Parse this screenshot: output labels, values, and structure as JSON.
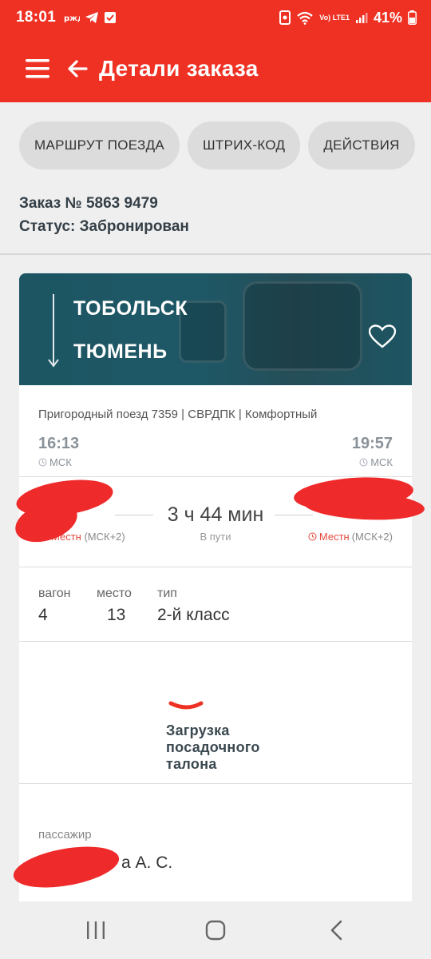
{
  "status_bar": {
    "time": "18:01",
    "battery_percent": "41%",
    "network_label": "Vo) LTE1"
  },
  "app_bar": {
    "title": "Детали заказа"
  },
  "chips": [
    {
      "label": "МАРШРУТ ПОЕЗДА"
    },
    {
      "label": "ШТРИХ-КОД"
    },
    {
      "label": "ДЕЙСТВИЯ"
    }
  ],
  "order": {
    "number_line": "Заказ № 5863 9479",
    "status_line": "Статус: Забронирован"
  },
  "route": {
    "from_city": "ТОБОЛЬСК",
    "to_city": "ТЮМЕНЬ"
  },
  "trip": {
    "description": "Пригородный поезд 7359 | СВРДПК | Комфортный",
    "departure_time_msk": "16:13",
    "arrival_time_msk": "19:57",
    "timezone_msk": "МСК",
    "duration": "3 ч 44 мин",
    "duration_label": "В пути",
    "local_label": "Местн",
    "local_offset": "(МСК+2)"
  },
  "seat": {
    "headers": [
      "вагон",
      "место",
      "тип"
    ],
    "values": [
      "4",
      "13",
      "2-й класс"
    ]
  },
  "boarding_pass": {
    "loading_lines": [
      "Загрузка",
      "посадочного",
      "талона"
    ]
  },
  "passenger": {
    "label": "пассажир",
    "name_visible": "а А. С."
  },
  "colors": {
    "brand_red": "#ef3124",
    "header_teal": "#1d5562"
  }
}
